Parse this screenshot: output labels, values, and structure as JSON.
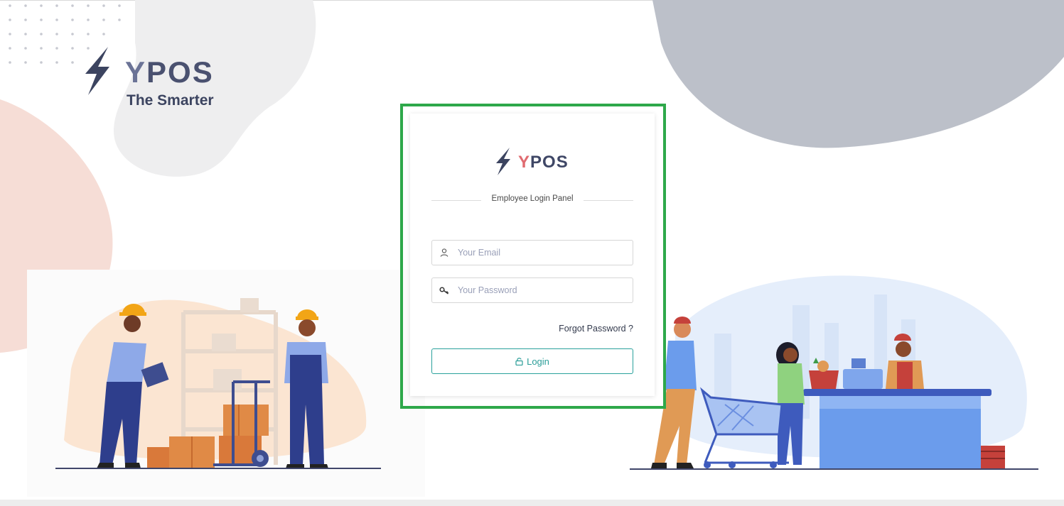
{
  "brand": {
    "name_y": "Y",
    "name_rest": "POS",
    "tagline": "The Smarter"
  },
  "card": {
    "logo_y": "Y",
    "logo_rest": "POS",
    "panel_title": "Employee Login Panel",
    "email_placeholder": "Your Email",
    "password_placeholder": "Your Password",
    "forgot_label": "Forgot Password ?",
    "login_label": "Login",
    "highlight_color": "#2ea84a"
  },
  "icons": {
    "email": "user-icon",
    "password": "key-icon",
    "login": "lock-icon",
    "logo": "lightning-bolt-icon"
  }
}
